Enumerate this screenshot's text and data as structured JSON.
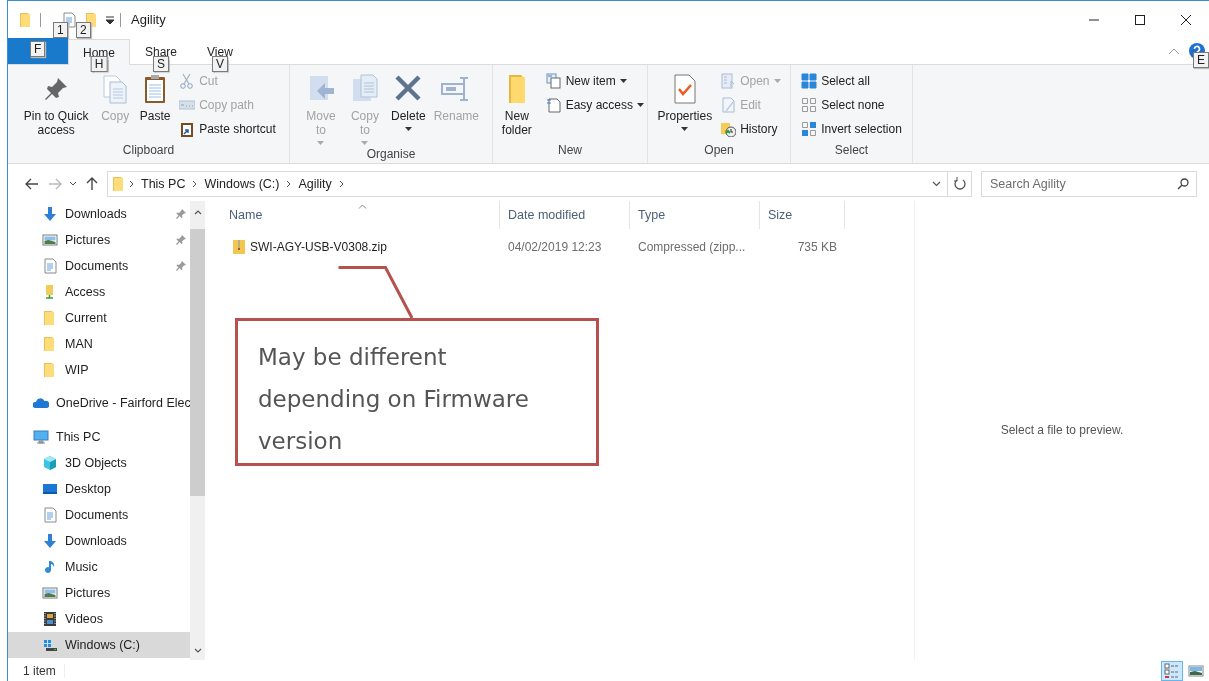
{
  "window": {
    "title": "Agility"
  },
  "quick_access_toolbar": {
    "keytips": [
      "1",
      "2"
    ]
  },
  "ribbon": {
    "file_keytip": "F",
    "tabs": [
      {
        "label": "Home",
        "keytip": "H",
        "selected": true
      },
      {
        "label": "Share",
        "keytip": "S",
        "selected": false
      },
      {
        "label": "View",
        "keytip": "V",
        "selected": false
      }
    ],
    "help_keytip": "E",
    "groups": [
      {
        "name": "Clipboard",
        "items": [
          {
            "label": "Pin to Quick access",
            "kind": "large",
            "disabled": false,
            "dropdown": false
          },
          {
            "label": "Copy",
            "kind": "large",
            "disabled": true,
            "dropdown": false
          },
          {
            "label": "Paste",
            "kind": "large",
            "disabled": false,
            "dropdown": false
          },
          {
            "label": "Cut",
            "kind": "small",
            "disabled": true,
            "dropdown": false
          },
          {
            "label": "Copy path",
            "kind": "small",
            "disabled": true,
            "dropdown": false
          },
          {
            "label": "Paste shortcut",
            "kind": "small",
            "disabled": false,
            "dropdown": false
          }
        ]
      },
      {
        "name": "Organise",
        "items": [
          {
            "label": "Move to",
            "kind": "large",
            "disabled": true,
            "dropdown": true
          },
          {
            "label": "Copy to",
            "kind": "large",
            "disabled": true,
            "dropdown": true
          },
          {
            "label": "Delete",
            "kind": "large",
            "disabled": false,
            "dropdown": true
          },
          {
            "label": "Rename",
            "kind": "large",
            "disabled": true,
            "dropdown": false
          }
        ]
      },
      {
        "name": "New",
        "items": [
          {
            "label": "New folder",
            "kind": "large",
            "disabled": false,
            "dropdown": false
          },
          {
            "label": "New item",
            "kind": "small",
            "disabled": false,
            "dropdown": true
          },
          {
            "label": "Easy access",
            "kind": "small",
            "disabled": false,
            "dropdown": true
          }
        ]
      },
      {
        "name": "Open",
        "items": [
          {
            "label": "Properties",
            "kind": "large",
            "disabled": false,
            "dropdown": true
          },
          {
            "label": "Open",
            "kind": "small",
            "disabled": true,
            "dropdown": true
          },
          {
            "label": "Edit",
            "kind": "small",
            "disabled": true,
            "dropdown": false
          },
          {
            "label": "History",
            "kind": "small",
            "disabled": false,
            "dropdown": false
          }
        ]
      },
      {
        "name": "Select",
        "items": [
          {
            "label": "Select all",
            "kind": "small",
            "disabled": false,
            "dropdown": false
          },
          {
            "label": "Select none",
            "kind": "small",
            "disabled": false,
            "dropdown": false
          },
          {
            "label": "Invert selection",
            "kind": "small",
            "disabled": false,
            "dropdown": false
          }
        ]
      }
    ]
  },
  "address_bar": {
    "path": [
      "This PC",
      "Windows (C:)",
      "Agility"
    ]
  },
  "search": {
    "placeholder": "Search Agility"
  },
  "navigation_pane": {
    "quick_access": [
      {
        "label": "Downloads",
        "pinned": true,
        "selected": false
      },
      {
        "label": "Pictures",
        "pinned": true,
        "selected": false
      },
      {
        "label": "Documents",
        "pinned": true,
        "selected": false
      },
      {
        "label": "Access",
        "pinned": false,
        "selected": false
      },
      {
        "label": "Current",
        "pinned": false,
        "selected": false
      },
      {
        "label": "MAN",
        "pinned": false,
        "selected": false
      },
      {
        "label": "WIP",
        "pinned": false,
        "selected": false
      }
    ],
    "onedrive": {
      "label": "OneDrive - Fairford Elec",
      "selected": false
    },
    "this_pc": {
      "label": "This PC",
      "selected": false,
      "children": [
        {
          "label": "3D Objects",
          "selected": false
        },
        {
          "label": "Desktop",
          "selected": false
        },
        {
          "label": "Documents",
          "selected": false
        },
        {
          "label": "Downloads",
          "selected": false
        },
        {
          "label": "Music",
          "selected": false
        },
        {
          "label": "Pictures",
          "selected": false
        },
        {
          "label": "Videos",
          "selected": false
        },
        {
          "label": "Windows (C:)",
          "selected": true
        }
      ]
    }
  },
  "file_list": {
    "columns": [
      {
        "label": "Name",
        "sorted": true
      },
      {
        "label": "Date modified",
        "sorted": false
      },
      {
        "label": "Type",
        "sorted": false
      },
      {
        "label": "Size",
        "sorted": false
      }
    ],
    "rows": [
      {
        "cells": [
          "SWI-AGY-USB-V0308.zip",
          "04/02/2019 12:23",
          "Compressed (zipp...",
          "735 KB"
        ],
        "selected": false
      }
    ]
  },
  "preview": {
    "message": "Select a file to preview."
  },
  "callout": {
    "text": "May be different depending on Firmware version"
  },
  "status_bar": {
    "item_count": "1 item",
    "views": [
      {
        "selected": true
      },
      {
        "selected": false
      }
    ]
  }
}
